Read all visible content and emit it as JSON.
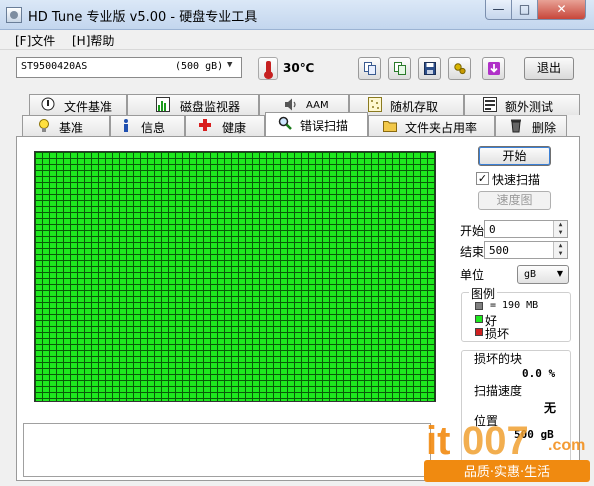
{
  "window": {
    "title": "HD Tune 专业版 v5.00 - 硬盘专业工具"
  },
  "menu": {
    "items": [
      "[F]文件",
      "[H]帮助"
    ]
  },
  "toolbar": {
    "drive_name": "ST9500420AS",
    "drive_size": "(500 gB)",
    "temperature": "30℃",
    "exit_label": "退出"
  },
  "tabs": {
    "row1": [
      "文件基准",
      "磁盘监视器",
      "AAM",
      "随机存取",
      "额外测试"
    ],
    "row2": [
      "基准",
      "信息",
      "健康",
      "错误扫描",
      "文件夹占用率",
      "删除"
    ],
    "active": "错误扫描"
  },
  "scan": {
    "start_label": "开始",
    "quick_scan_label": "快速扫描",
    "quick_scan_checked": true,
    "speed_map_label": "速度图",
    "start_field_label": "开始",
    "start_value": "0",
    "end_field_label": "结束",
    "end_value": "500",
    "unit_label": "单位",
    "unit_value": "gB"
  },
  "legend": {
    "title": "图例",
    "block_size": "= 190 MB",
    "good": "好",
    "damaged": "损坏",
    "colors": {
      "block": "#808080",
      "good": "#1ee81e",
      "damaged": "#d02020"
    }
  },
  "stats": {
    "damaged_blocks_label": "损坏的块",
    "damaged_blocks_value": "0.0 %",
    "scan_speed_label": "扫描速度",
    "scan_speed_value": "无",
    "position_label": "位置",
    "position_value": "500 gB"
  },
  "watermark": {
    "brand": "it007.com",
    "slogan": "品质·实惠·生活"
  }
}
